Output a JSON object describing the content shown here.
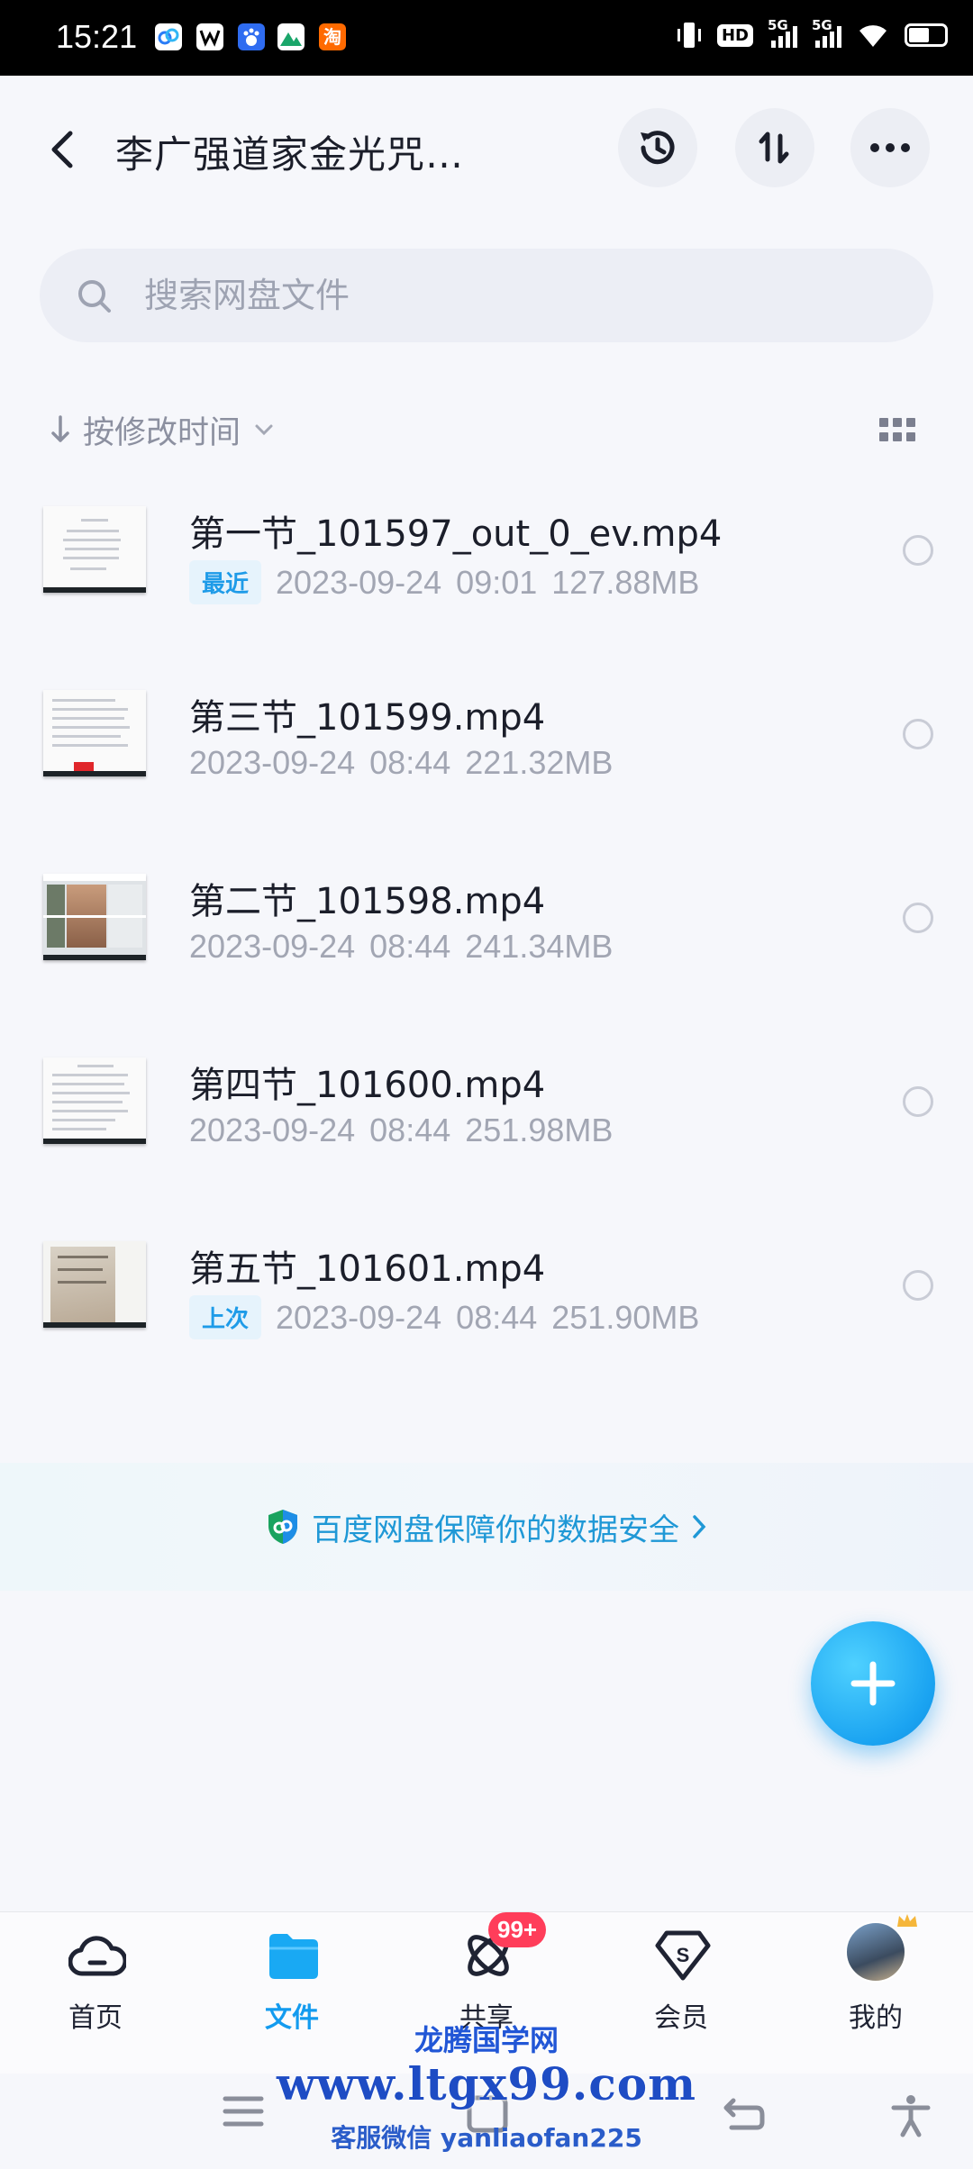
{
  "status_bar": {
    "time": "15:21",
    "hd_label": "HD",
    "sim1_label": "5G",
    "sim2_label": "5G",
    "app_icons": [
      "baidu-netdisk-icon",
      "wps-icon",
      "baidu-icon",
      "photos-icon",
      "taobao-icon"
    ]
  },
  "header": {
    "title": "李广强道家金光咒…",
    "back_icon": "back-arrow-icon",
    "actions": [
      "history-icon",
      "sort-icon",
      "more-icon"
    ]
  },
  "search": {
    "placeholder": "搜索网盘文件",
    "value": ""
  },
  "sort": {
    "label": "按修改时间"
  },
  "files": [
    {
      "name": "第一节_101597_out_0_ev.mp4",
      "badge": "最近",
      "date": "2023-09-24",
      "time": "09:01",
      "size": "127.88MB"
    },
    {
      "name": "第三节_101599.mp4",
      "badge": "",
      "date": "2023-09-24",
      "time": "08:44",
      "size": "221.32MB"
    },
    {
      "name": "第二节_101598.mp4",
      "badge": "",
      "date": "2023-09-24",
      "time": "08:44",
      "size": "241.34MB"
    },
    {
      "name": "第四节_101600.mp4",
      "badge": "",
      "date": "2023-09-24",
      "time": "08:44",
      "size": "251.98MB"
    },
    {
      "name": "第五节_101601.mp4",
      "badge": "上次",
      "date": "2023-09-24",
      "time": "08:44",
      "size": "251.90MB"
    }
  ],
  "banner": {
    "text": "百度网盘保障你的数据安全"
  },
  "bottom_nav": {
    "items": [
      {
        "label": "首页",
        "icon": "cloud-home-icon"
      },
      {
        "label": "文件",
        "icon": "folder-icon"
      },
      {
        "label": "共享",
        "icon": "share-atom-icon",
        "badge": "99+"
      },
      {
        "label": "会员",
        "icon": "vip-diamond-icon"
      },
      {
        "label": "我的",
        "icon": "avatar"
      }
    ]
  },
  "watermark": {
    "site": "龙腾国学网",
    "url": "www.ltgx99.com",
    "wechat": "客服微信 yanliaofan225"
  },
  "colors": {
    "accent": "#139bef",
    "badge_red": "#ff3d5a",
    "banner_text": "#1f98d6"
  }
}
